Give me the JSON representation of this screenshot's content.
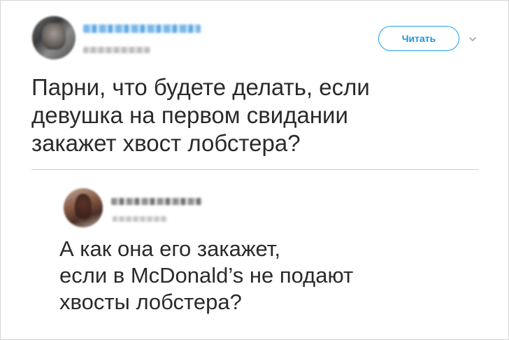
{
  "tweet": {
    "text": "Парни, что будете делать, если\nдевушка на первом свидании\nзакажет хвост лобстера?",
    "follow_label": "Читать"
  },
  "reply": {
    "text": "А как она его закажет,\nесли в McDonald’s не подают\nхвосты лобстера?"
  },
  "icons": {
    "more": "chevron-down-icon"
  },
  "colors": {
    "accent": "#1da1f2",
    "text": "#2a2a2a",
    "divider": "#cfcfcf"
  }
}
